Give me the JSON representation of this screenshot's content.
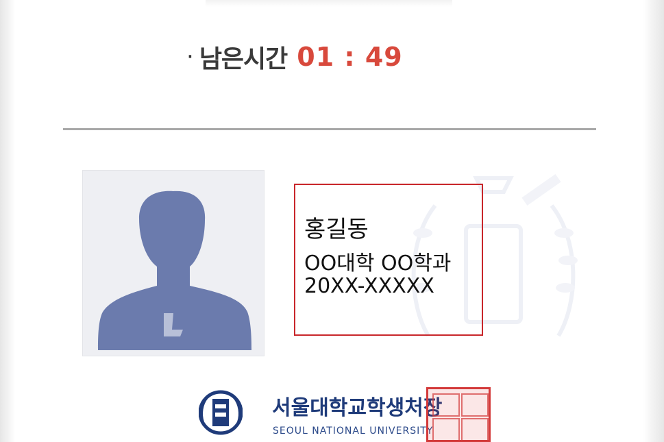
{
  "timer": {
    "bullet": "·",
    "label": "남은시간",
    "value": "01 : 49"
  },
  "student": {
    "name": "홍길동",
    "department": "OO대학 OO학과",
    "student_id": "20XX-XXXXX"
  },
  "footer": {
    "issuer": "서울대학교학생처장",
    "issuer_en": "SEOUL NATIONAL UNIVERSITY"
  },
  "colors": {
    "timer_value": "#d8493c",
    "highlight_box": "#c8262a",
    "issuer": "#1f3b7a",
    "silhouette": "#6b7bad",
    "stamp": "#d33a3a"
  },
  "icons": {
    "photo": "person-silhouette-icon",
    "logo": "university-emblem-icon",
    "watermark": "university-emblem-watermark-icon",
    "stamp": "official-seal-stamp-icon"
  }
}
